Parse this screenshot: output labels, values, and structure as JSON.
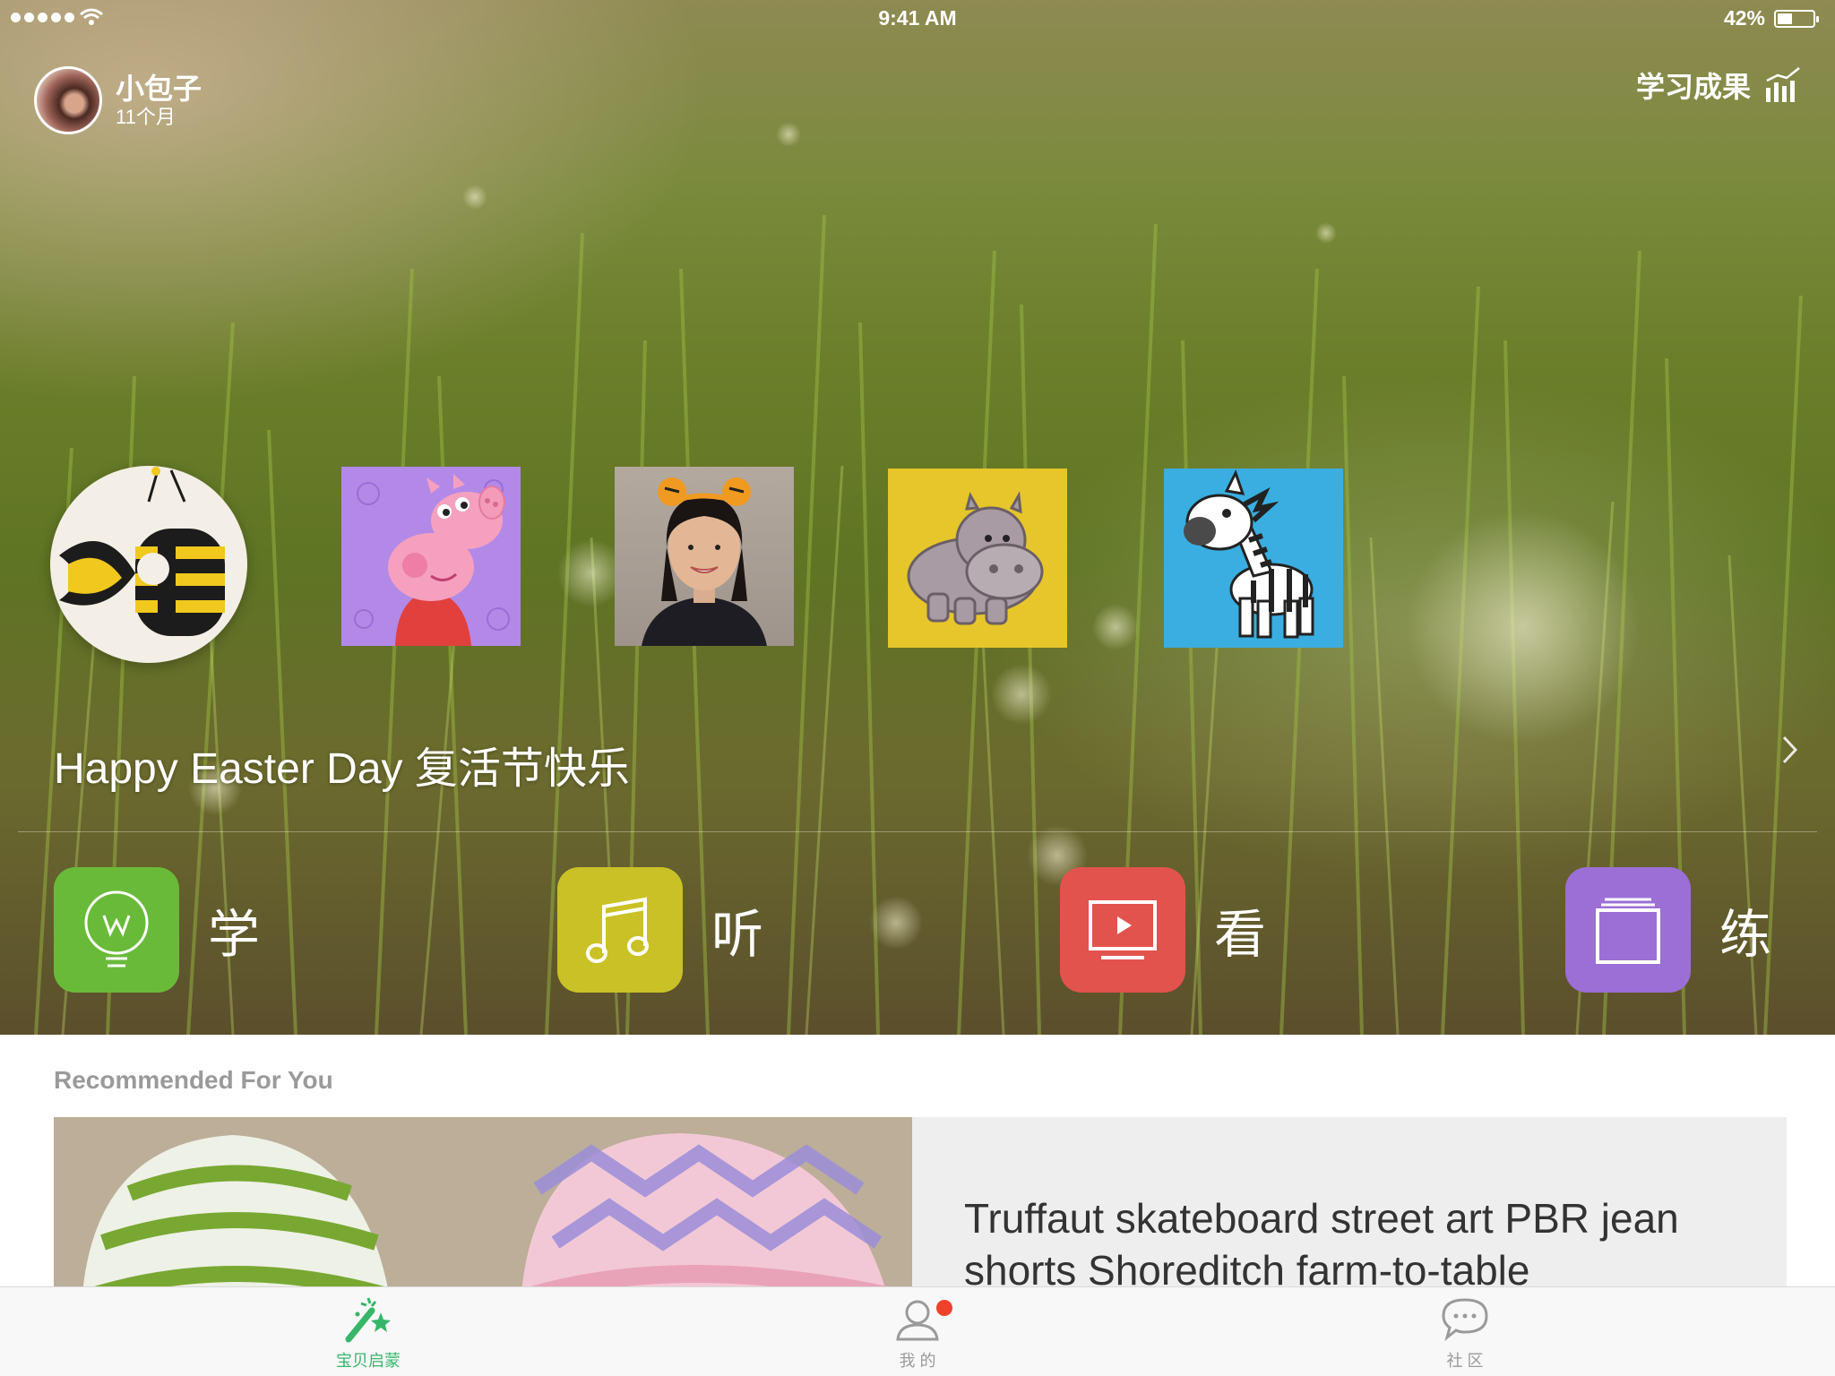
{
  "status_bar": {
    "time": "9:41 AM",
    "battery_percent_label": "42%",
    "battery_level": 0.42
  },
  "profile": {
    "name": "小包子",
    "age": "11个月"
  },
  "header": {
    "results_label": "学习成果",
    "results_icon": "bar-chart-icon"
  },
  "featured": {
    "title": "Happy Easter Day 复活节快乐",
    "items": [
      {
        "name": "bee-letter-b"
      },
      {
        "name": "peppa-pig"
      },
      {
        "name": "tiger-ears-host"
      },
      {
        "name": "hippo"
      },
      {
        "name": "zebra"
      }
    ]
  },
  "categories": [
    {
      "label": "学",
      "icon": "lightbulb-icon",
      "color": "#6aba3a"
    },
    {
      "label": "听",
      "icon": "music-note-icon",
      "color": "#c9c126"
    },
    {
      "label": "看",
      "icon": "video-play-icon",
      "color": "#e2534d"
    },
    {
      "label": "练",
      "icon": "cards-icon",
      "color": "#9b6fd6"
    }
  ],
  "recommended": {
    "section_title": "Recommended For You",
    "card_text": "Truffaut skateboard street art PBR jean shorts Shoreditch farm-to-table"
  },
  "tabs": [
    {
      "label": "宝贝启蒙",
      "icon": "magic-wand-icon",
      "active": true,
      "color": "#37b66a"
    },
    {
      "label": "我 的",
      "icon": "person-icon",
      "active": false,
      "badge": true
    },
    {
      "label": "社 区",
      "icon": "chat-bubble-icon",
      "active": false
    }
  ]
}
